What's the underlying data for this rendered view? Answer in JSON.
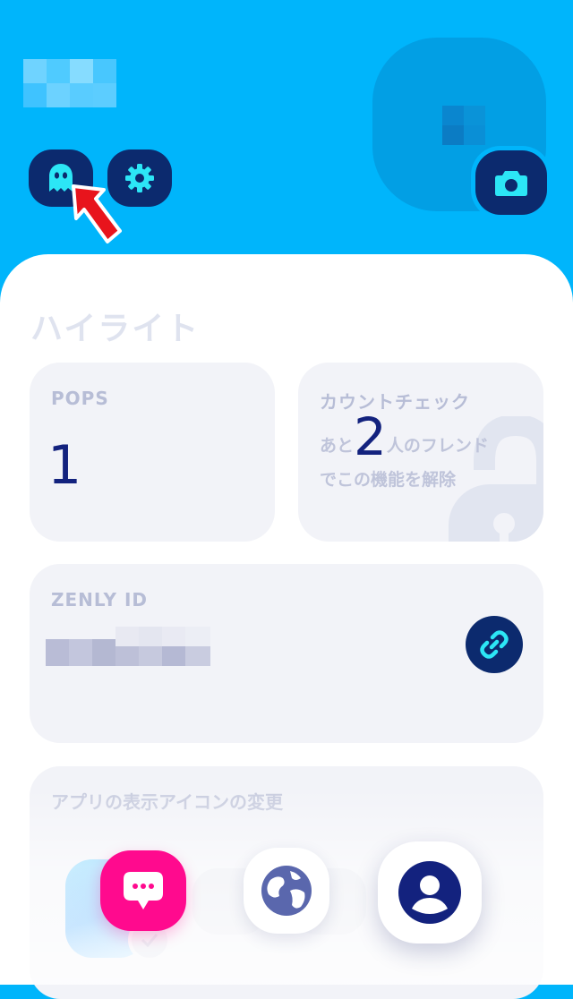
{
  "header": {
    "username_redacted": true,
    "ghost_button_icon": "ghost-icon",
    "settings_button_icon": "gear-icon",
    "camera_button_icon": "camera-icon",
    "accent_color": "#00b5fb",
    "button_color": "#0c2a6e",
    "button_icon_color": "#2ce6f6"
  },
  "highlights": {
    "title": "ハイライト",
    "pops": {
      "label": "POPS",
      "value": "1"
    },
    "count_check": {
      "label": "カウントチェック",
      "prefix": "あと",
      "number": "2",
      "suffix": "人のフレンド",
      "line2": "でこの機能を解除",
      "icon": "lock-icon"
    },
    "zenly_id": {
      "label": "ZENLY ID",
      "value_redacted": true,
      "icon": "link-icon"
    },
    "app_icon": {
      "label": "アプリの表示アイコンの変更"
    }
  },
  "nav": {
    "items": [
      {
        "name": "chat",
        "icon": "chat-bubble-icon",
        "color": "#ff0a8e"
      },
      {
        "name": "map",
        "icon": "globe-icon",
        "color": "#ffffff"
      },
      {
        "name": "profile",
        "icon": "person-icon",
        "color": "#ffffff",
        "active": true
      }
    ]
  }
}
